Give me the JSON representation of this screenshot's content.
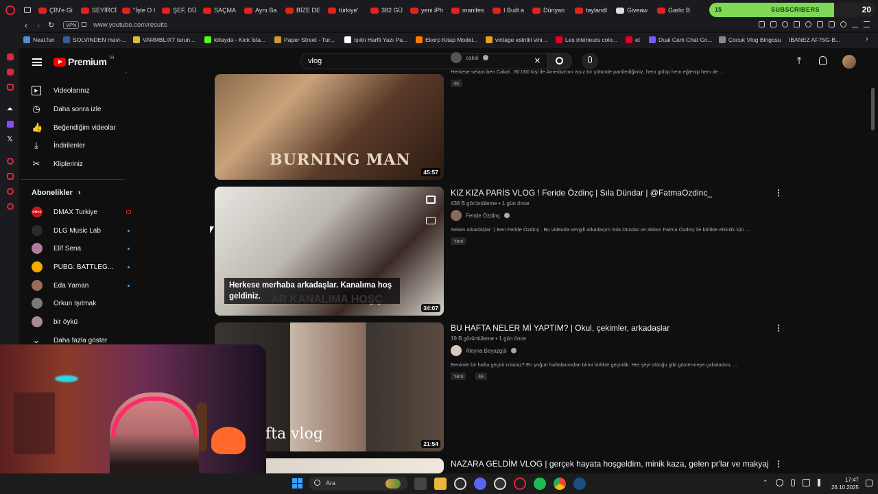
{
  "tabs": [
    {
      "label": "ÇİN'e Gi",
      "x": 0
    },
    {
      "label": "SEYİRCİ",
      "x": 1
    },
    {
      "label": "\"İşte O I",
      "x": 2
    },
    {
      "label": "ŞEF, DÜ",
      "x": 3
    },
    {
      "label": "SAÇMA",
      "x": 4
    },
    {
      "label": "Aynı Ba",
      "x": 5
    },
    {
      "label": "BİZE DE",
      "x": 6
    },
    {
      "label": "türkiye'",
      "x": 7
    },
    {
      "label": "382 GÜ",
      "x": 8
    },
    {
      "label": "yeni iPh",
      "x": 9
    },
    {
      "label": "manifes",
      "x": 10
    },
    {
      "label": "I Built a",
      "x": 11
    },
    {
      "label": "Dünyan",
      "x": 12
    },
    {
      "label": "taylandl",
      "x": 13
    },
    {
      "label": "Giveaw",
      "x": 14
    },
    {
      "label": "Garlic B",
      "x": 15
    }
  ],
  "subscribers_widget": {
    "left": "15",
    "label": "SUBSCRIBERS",
    "right": "20"
  },
  "address": {
    "vpn": "VPN",
    "url": "www.youtube.com/results"
  },
  "bookmarks": [
    "Neal.fun",
    "SOLVINDEN mavi-...",
    "VARMBLIXT turun...",
    "killayda - Kick İsta...",
    "Paper Street - Tur...",
    "Işıklı Harfli Yazı Pa...",
    "Ekorp Kitap Model...",
    "vintage esintili vini...",
    "Les intérieurs colo...",
    "et",
    "Dual Cam Chat Co...",
    "Çocuk Vlog Bingosu",
    "IBANEZ AF75G-B..."
  ],
  "youtube": {
    "logo": "Premium",
    "logo_country": "TR",
    "search_value": "vlog",
    "sidebar": {
      "items": [
        {
          "label": "Videolarınız",
          "icon": "play-square-icon"
        },
        {
          "label": "Daha sonra izle",
          "icon": "clock-icon"
        },
        {
          "label": "Beğendiğim videolar",
          "icon": "thumb-up-icon"
        },
        {
          "label": "İndirilenler",
          "icon": "download-icon"
        },
        {
          "label": "Klipleriniz",
          "icon": "scissors-icon"
        }
      ],
      "subs_header": "Abonelikler",
      "subs": [
        {
          "label": "DMAX Turkiye",
          "color": "#c4161c",
          "avatar_text": "DMAX",
          "indicator": "live"
        },
        {
          "label": "DLG Music Lab",
          "color": "#2a2a2a",
          "avatar_text": "",
          "indicator": "dot"
        },
        {
          "label": "Elif Sena",
          "color": "#b47a9a",
          "avatar_text": "",
          "indicator": "dot"
        },
        {
          "label": "PUBG: BATTLEG...",
          "color": "#f2a900",
          "avatar_text": "",
          "indicator": "dot"
        },
        {
          "label": "Eda Yaman",
          "color": "#9b6b5a",
          "avatar_text": "",
          "indicator": "dot"
        },
        {
          "label": "Orkun Işıtmak",
          "color": "#7a7a7a",
          "avatar_text": "",
          "indicator": "none"
        },
        {
          "label": "bir öykü",
          "color": "#a88a9a",
          "avatar_text": "",
          "indicator": "none"
        }
      ],
      "show_more": "Daha fazla göster"
    },
    "videos": [
      {
        "title": "",
        "views": "",
        "age": "",
        "channel": "cakal",
        "desc": "Herkese selam ben Cakal , 80.000 kişi ile Amerika'nın ıssız bir çölünde partilediğimiz, hem gülüp hem eğlenip hem de ...",
        "badges": [
          "4K"
        ],
        "duration": "45:57",
        "thumb_text": "BURNING MAN"
      },
      {
        "title": "KIZ KIZA PARİS VLOG ! Feride Özdinç | Sıla Dündar | @FatmaOzdinc_",
        "views": "438 B görüntüleme",
        "age": "1 gün önce",
        "channel": "Feride Özdinç",
        "desc": "Selam arkadaşlar :) Ben Feride Özdinç . Bu videoda sevgili arkadaşım Sıla Dündar ve ablam Fatma Özdinç ile birlikte etkinlik için ...",
        "badges": [
          "Yeni"
        ],
        "duration": "34:07",
        "caption": "Herkese merhaba arkadaşlar. Kanalıma hoş geldiniz.",
        "thumb_text": "AR KANALIMA HOŞÇ"
      },
      {
        "title": "BU HAFTA NELER Mİ YAPTIM? | Okul, çekimler, arkadaşlar",
        "views": "19 B görüntüleme",
        "age": "1 gün önce",
        "channel": "Aleyna Beyazgül",
        "desc": "Benimle bir hafta geçirir misiniz? En yoğun haftalarımdan birini birlikte geçirdik. Her şeyi olduğu gibi göstermeye çabaladım, ...",
        "badges": [
          "Yeni",
          "4K"
        ],
        "duration": "21:54",
        "thumb_text": "fta vlog"
      },
      {
        "title": "NAZARA GELDİM VLOG | gerçek hayata hoşgeldim, minik kaza, gelen pr'lar ve makyaj",
        "views": "",
        "age": "",
        "channel": "",
        "desc": "",
        "badges": [],
        "duration": ""
      }
    ]
  },
  "taskbar": {
    "search_label": "Ara",
    "time": "17:47",
    "date": "26.10.2025"
  },
  "colors": {
    "youtube_red": "#ff0000",
    "bg": "#0f0f0f",
    "accent_blue": "#3ea6ff",
    "sub_green": "#7ed957"
  }
}
